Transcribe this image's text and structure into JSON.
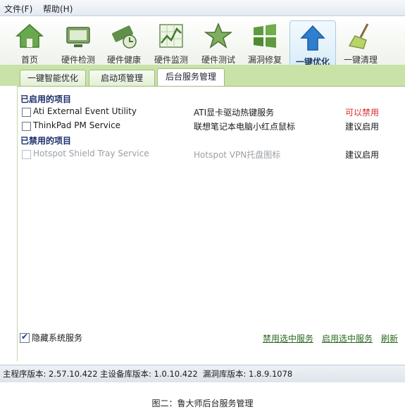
{
  "menubar": {
    "file": "文件(F)",
    "help": "帮助(H)"
  },
  "toolbar": {
    "items": [
      {
        "label": "首页"
      },
      {
        "label": "硬件检测"
      },
      {
        "label": "硬件健康"
      },
      {
        "label": "硬件监测"
      },
      {
        "label": "硬件测试"
      },
      {
        "label": "漏洞修复"
      },
      {
        "label": "一键优化"
      },
      {
        "label": "一键清理"
      }
    ],
    "active_index": 6
  },
  "subtabs": [
    {
      "label": "一键智能优化"
    },
    {
      "label": "启动项管理"
    },
    {
      "label": "后台服务管理"
    }
  ],
  "enabled_section": {
    "title": "已启用的项目",
    "rows": [
      {
        "name": "Ati External Event Utility",
        "desc": "ATI显卡驱动热键服务",
        "action": "可以禁用"
      },
      {
        "name": "ThinkPad PM Service",
        "desc": "联想笔记本电脑小红点鼠标",
        "action": "建议启用"
      }
    ]
  },
  "disabled_section": {
    "title": "已禁用的项目",
    "rows": [
      {
        "name": "Hotspot Shield Tray Service",
        "desc": "Hotspot VPN托盘图标",
        "action": "建议启用"
      }
    ]
  },
  "footer": {
    "hide_system_label": "隐藏系统服务",
    "hide_system_checked": true,
    "disable_selected": "禁用选中服务",
    "enable_selected": "启用选中服务",
    "refresh": "刷新"
  },
  "status": {
    "main_version": "主程序版本: 2.57.10.422",
    "device_db_version": "主设备库版本: 1.0.10.422",
    "vuln_db_version": "漏洞库版本: 1.8.9.1078"
  },
  "caption": "图二：鲁大师后台服务管理",
  "colors": {
    "can_disable": "#d62b2b",
    "section_title": "#1a2f6b",
    "link": "#2b6a1e",
    "accent_green": "#c8e2a8"
  }
}
